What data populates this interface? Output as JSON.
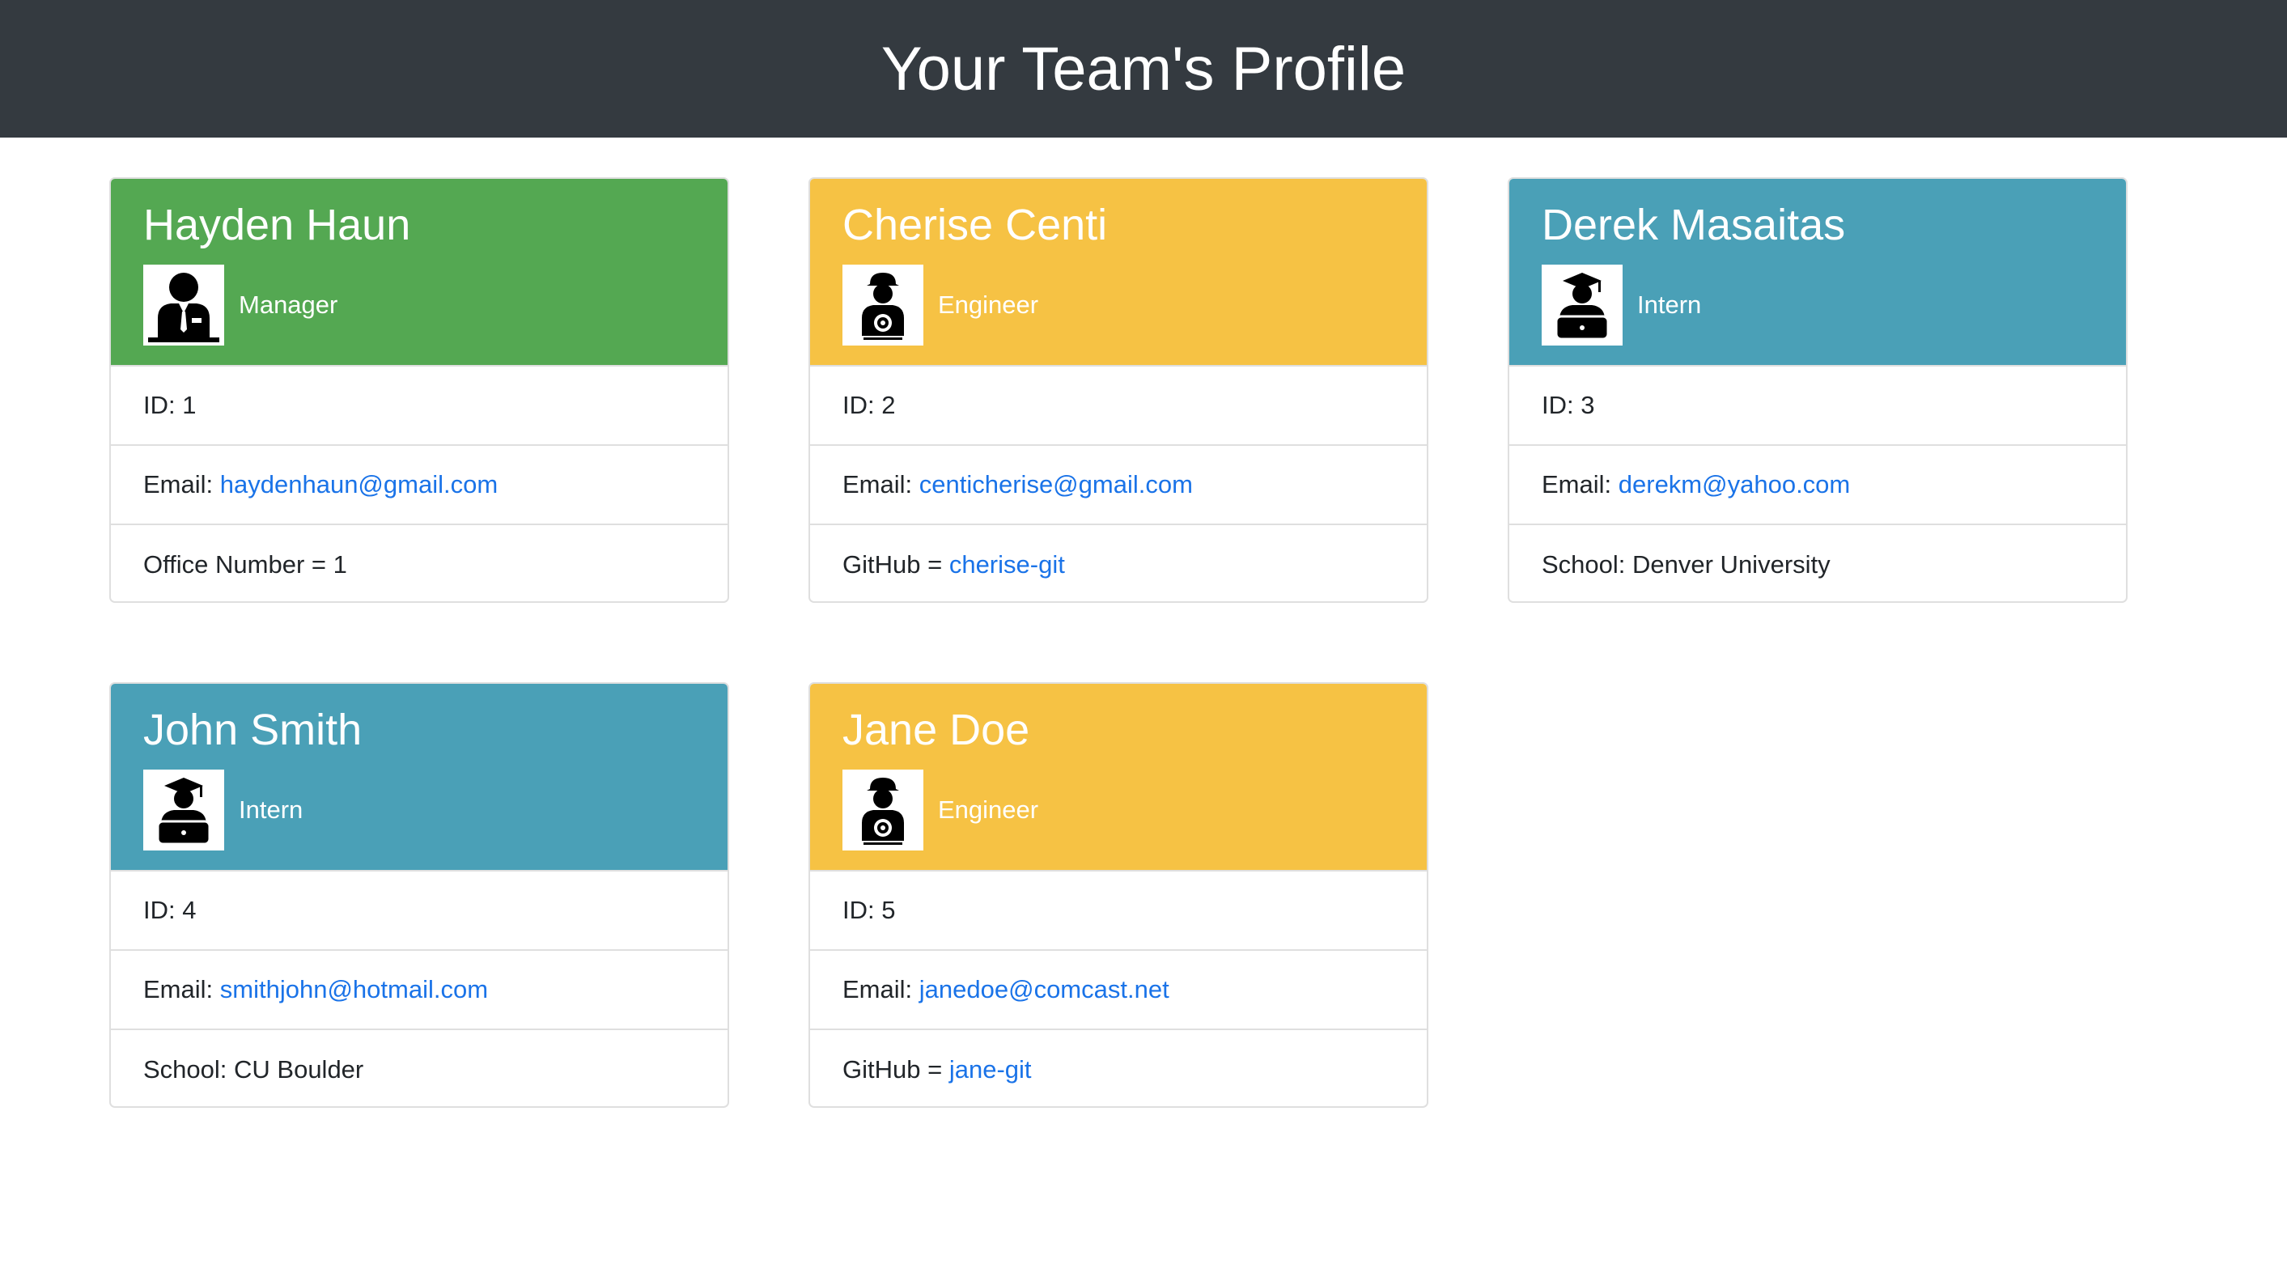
{
  "header": {
    "title": "Your Team's Profile"
  },
  "colors": {
    "manager": "#54a852",
    "engineer": "#f6c244",
    "intern": "#4aa0b7",
    "link": "#1a73e8",
    "navbar": "#343a40"
  },
  "employees": [
    {
      "name": "Hayden Haun",
      "role": "Manager",
      "icon": "manager-icon",
      "id": "ID: 1",
      "email_label": "Email: ",
      "email": "haydenhaun@gmail.com",
      "extra_label": "Office Number = 1",
      "extra_link": ""
    },
    {
      "name": "Cherise Centi",
      "role": "Engineer",
      "icon": "engineer-icon",
      "id": "ID: 2",
      "email_label": "Email: ",
      "email": "centicherise@gmail.com",
      "extra_label": "GitHub = ",
      "extra_link": "cherise-git"
    },
    {
      "name": "Derek Masaitas",
      "role": "Intern",
      "icon": "intern-icon",
      "id": "ID: 3",
      "email_label": "Email: ",
      "email": "derekm@yahoo.com",
      "extra_label": "School: Denver University",
      "extra_link": ""
    },
    {
      "name": "John Smith",
      "role": "Intern",
      "icon": "intern-icon",
      "id": "ID: 4",
      "email_label": "Email: ",
      "email": "smithjohn@hotmail.com",
      "extra_label": "School: CU Boulder",
      "extra_link": ""
    },
    {
      "name": "Jane Doe",
      "role": "Engineer",
      "icon": "engineer-icon",
      "id": "ID: 5",
      "email_label": "Email: ",
      "email": "janedoe@comcast.net",
      "extra_label": "GitHub = ",
      "extra_link": "jane-git"
    }
  ]
}
